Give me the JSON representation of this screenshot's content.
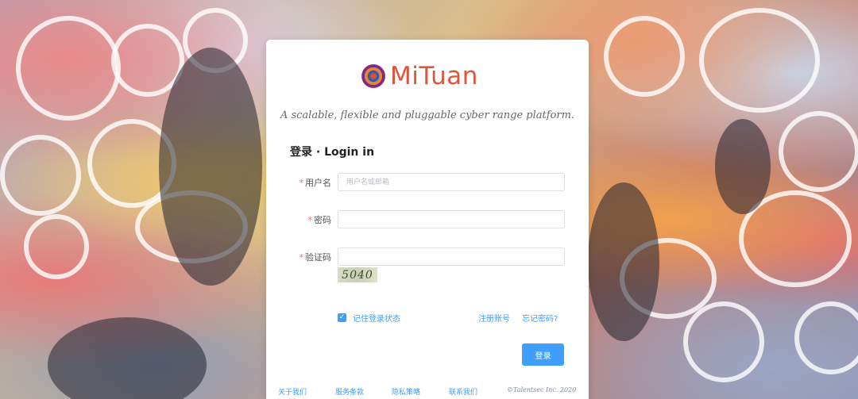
{
  "brand": {
    "logo_text": "MiTuan",
    "slogan": "A scalable, flexible and pluggable cyber range platform."
  },
  "login": {
    "title": "登录 · Login in",
    "fields": {
      "username": {
        "label": "用户名",
        "placeholder": "用户名或邮箱",
        "value": ""
      },
      "password": {
        "label": "密码",
        "value": ""
      },
      "captcha": {
        "label": "验证码",
        "value": "",
        "image_text": "5040"
      }
    },
    "remember_label": "记住登录状态",
    "remember_checked": true,
    "register_link": "注册账号",
    "forgot_link": "忘记密码?",
    "submit_label": "登录"
  },
  "footer": {
    "links": [
      "关于我们",
      "服务条款",
      "隐私策略",
      "联系我们"
    ],
    "copyright": "©Talentsec Inc. 2020"
  },
  "colors": {
    "primary": "#409eff",
    "brand": "#e0543b",
    "required": "#f56c6c"
  },
  "icons": {
    "logo": "spiral-logo-icon",
    "checkbox": "check-icon"
  }
}
